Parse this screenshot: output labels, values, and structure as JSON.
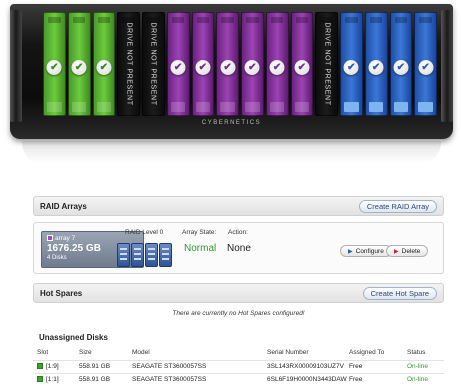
{
  "chassis": {
    "brand": "CYBERNETICS",
    "bays": [
      {
        "color": "green",
        "state": "ok"
      },
      {
        "color": "green",
        "state": "ok"
      },
      {
        "color": "green",
        "state": "ok"
      },
      {
        "color": "empty",
        "state": "empty",
        "label": "DRIVE NOT PRESENT"
      },
      {
        "color": "empty",
        "state": "empty",
        "label": "DRIVE NOT PRESENT"
      },
      {
        "color": "purple",
        "state": "ok"
      },
      {
        "color": "purple",
        "state": "ok"
      },
      {
        "color": "purple",
        "state": "ok"
      },
      {
        "color": "purple",
        "state": "ok"
      },
      {
        "color": "purple",
        "state": "ok"
      },
      {
        "color": "purple",
        "state": "ok"
      },
      {
        "color": "empty",
        "state": "empty",
        "label": "DRIVE NOT PRESENT"
      },
      {
        "color": "blue",
        "state": "ok"
      },
      {
        "color": "blue",
        "state": "ok"
      },
      {
        "color": "blue",
        "state": "ok"
      },
      {
        "color": "blue",
        "state": "ok"
      }
    ],
    "check_icon": "✔"
  },
  "raid": {
    "title": "RAID Arrays",
    "create_label": "Create RAID Array",
    "array": {
      "name": "array 7",
      "size": "1676.25 GB",
      "disks": "4 Disks",
      "swatch_color": "#a648c4",
      "level_label": "RAID Level 0",
      "state_label": "Array State:",
      "state_value": "Normal",
      "action_label": "Action:",
      "action_value": "None",
      "configure_label": "Configure",
      "delete_label": "Delete"
    }
  },
  "hot_spares": {
    "title": "Hot Spares",
    "create_label": "Create Hot Spare",
    "empty_note": "There are currently no Hot Spares configured!"
  },
  "unassigned": {
    "title": "Unassigned Disks",
    "columns": [
      "Slot",
      "Size",
      "Model",
      "Serial Number",
      "Assigned To",
      "Status"
    ],
    "rows": [
      {
        "slot": "[1:9]",
        "size": "558.91 GB",
        "model": "SEAGATE ST3600057SS",
        "serial": "3SL143RX00009103UZ7V",
        "assigned": "Free",
        "status": "On-line"
      },
      {
        "slot": "[1:1]",
        "size": "558.91 GB",
        "model": "SEAGATE ST3600057SS",
        "serial": "6SL6F19H0000N3443DAW",
        "assigned": "Free",
        "status": "On-line"
      }
    ]
  },
  "colors": {
    "normal_green": "#2f9a2f",
    "online_green": "#2f9a2f",
    "button_text_blue": "#2a4a7a"
  }
}
